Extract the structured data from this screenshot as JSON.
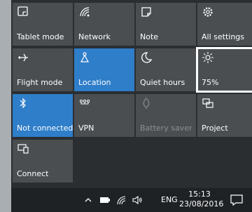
{
  "quick_actions": [
    {
      "label": "Tablet mode",
      "icon": "tablet-mode-icon",
      "state": "off"
    },
    {
      "label": "Network",
      "icon": "network-icon",
      "state": "off"
    },
    {
      "label": "Note",
      "icon": "note-icon",
      "state": "off"
    },
    {
      "label": "All settings",
      "icon": "gear-icon",
      "state": "off"
    },
    {
      "label": "Flight mode",
      "icon": "airplane-icon",
      "state": "off"
    },
    {
      "label": "Location",
      "icon": "location-icon",
      "state": "on"
    },
    {
      "label": "Quiet hours",
      "icon": "moon-icon",
      "state": "off"
    },
    {
      "label": "75%",
      "icon": "brightness-icon",
      "state": "focused"
    },
    {
      "label": "Not connected",
      "icon": "bluetooth-icon",
      "state": "on"
    },
    {
      "label": "VPN",
      "icon": "vpn-icon",
      "state": "off"
    },
    {
      "label": "Battery saver",
      "icon": "battery-saver-icon",
      "state": "disabled"
    },
    {
      "label": "Project",
      "icon": "project-icon",
      "state": "off"
    },
    {
      "label": "Connect",
      "icon": "connect-icon",
      "state": "off"
    }
  ],
  "taskbar": {
    "language": "ENG",
    "time": "15:13",
    "date": "23/08/2016",
    "tray_icons": [
      "chevron-up-icon",
      "battery-icon",
      "wifi-icon",
      "volume-icon"
    ]
  },
  "colors": {
    "tile": "#4a4e51",
    "tile_active": "#2f7ec9",
    "panel": "#2b2e31",
    "taskbar": "#1f2225"
  }
}
